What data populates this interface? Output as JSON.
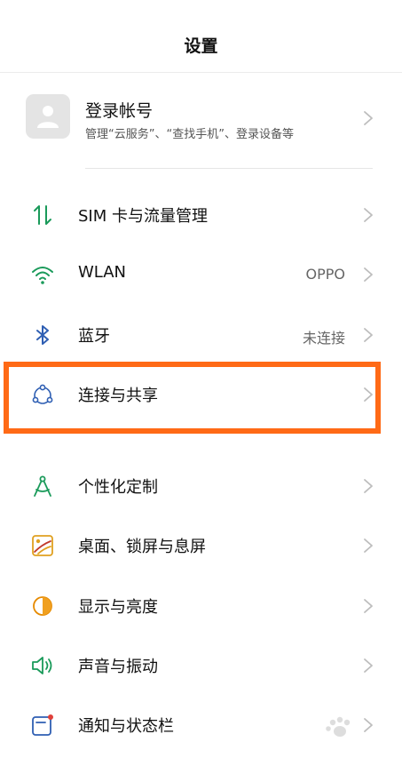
{
  "header": {
    "title": "设置"
  },
  "account": {
    "title": "登录帐号",
    "subtitle": "管理“云服务”、“查找手机”、登录设备等"
  },
  "rows": [
    {
      "label": "SIM 卡与流量管理",
      "value": "",
      "icon": "sim-data-icon",
      "color": "#1a9a5a"
    },
    {
      "label": "WLAN",
      "value": "OPPO",
      "icon": "wifi-icon",
      "color": "#1a9a5a"
    },
    {
      "label": "蓝牙",
      "value": "未连接",
      "icon": "bluetooth-icon",
      "color": "#2f5fb3"
    },
    {
      "label": "连接与共享",
      "value": "",
      "icon": "connection-share-icon",
      "color": "#2f5fb3"
    },
    {
      "label": "个性化定制",
      "value": "",
      "icon": "personalization-icon",
      "color": "#1a9a5a"
    },
    {
      "label": "桌面、锁屏与息屏",
      "value": "",
      "icon": "wallpaper-icon",
      "color": "#e0a020"
    },
    {
      "label": "显示与亮度",
      "value": "",
      "icon": "display-brightness-icon",
      "color": "#e68a00"
    },
    {
      "label": "声音与振动",
      "value": "",
      "icon": "sound-vibration-icon",
      "color": "#1a9a5a"
    },
    {
      "label": "通知与状态栏",
      "value": "",
      "icon": "notification-icon",
      "color": "#2f5fb3"
    }
  ],
  "highlight_color": "#ff6a16"
}
